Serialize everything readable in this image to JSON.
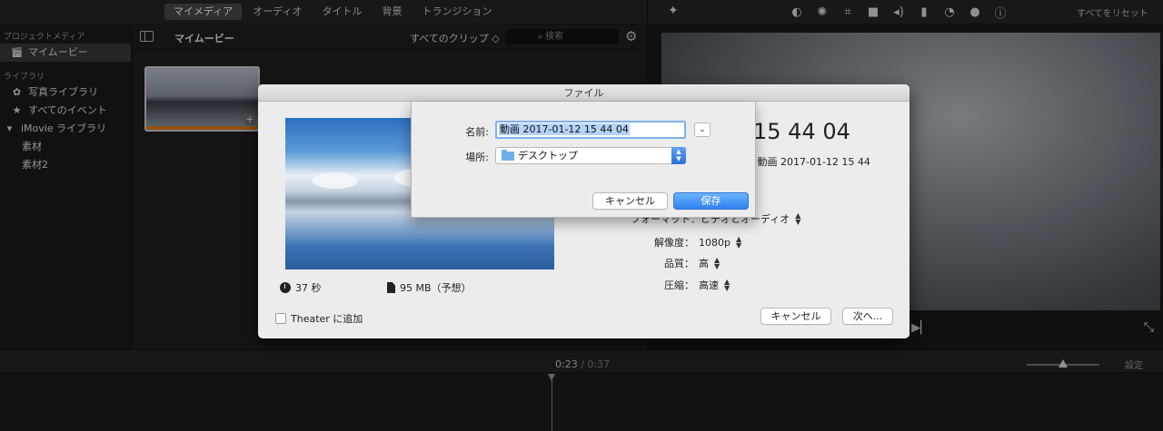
{
  "toolbar": {
    "tabs": [
      {
        "label": "マイメディア",
        "active": true
      },
      {
        "label": "オーディオ",
        "active": false
      },
      {
        "label": "タイトル",
        "active": false
      },
      {
        "label": "背景",
        "active": false
      },
      {
        "label": "トランジション",
        "active": false
      }
    ],
    "reset_all": "すべてをリセット",
    "viewer_tools": [
      "color-balance-icon",
      "palette-icon",
      "crop-icon",
      "stabilize-icon",
      "volume-icon",
      "equalizer-icon",
      "speed-icon",
      "filter-icon",
      "info-icon"
    ]
  },
  "sidebar": {
    "project_media_header": "プロジェクトメディア",
    "project_item": "マイムービー",
    "library_header": "ライブラリ",
    "items": [
      {
        "label": "写真ライブラリ"
      },
      {
        "label": "すべてのイベント"
      },
      {
        "label": "iMovie ライブラリ"
      }
    ],
    "sub_items": [
      {
        "label": "素材"
      },
      {
        "label": "素材2"
      }
    ]
  },
  "browser": {
    "title": "マイムービー",
    "clip_filter": "すべてのクリップ ◇",
    "search_placeholder": "検索"
  },
  "timeline": {
    "current": "0:23",
    "separator": "/",
    "total": "0:37",
    "settings": "設定"
  },
  "share_dialog": {
    "title": "ファイル",
    "movie_name": "15 44 04",
    "description": "は 動画 2017-01-12 15 44",
    "duration": "37 秒",
    "size": "95 MB（予想）",
    "format_label": "フォーマット：ビデオとオーディオ",
    "resolution_label": "解像度：",
    "resolution_value": "1080p",
    "quality_label": "品質：",
    "quality_value": "高",
    "compress_label": "圧縮：",
    "compress_value": "高速",
    "theater_label": "Theater に追加",
    "cancel": "キャンセル",
    "next": "次へ..."
  },
  "save_sheet": {
    "name_label": "名前:",
    "name_value": "動画 2017-01-12 15 44 04",
    "location_label": "場所:",
    "location_value": "デスクトップ",
    "cancel": "キャンセル",
    "save": "保存"
  },
  "colors": {
    "accent": "#2f82f0",
    "clip_bar": "#e07b20"
  }
}
